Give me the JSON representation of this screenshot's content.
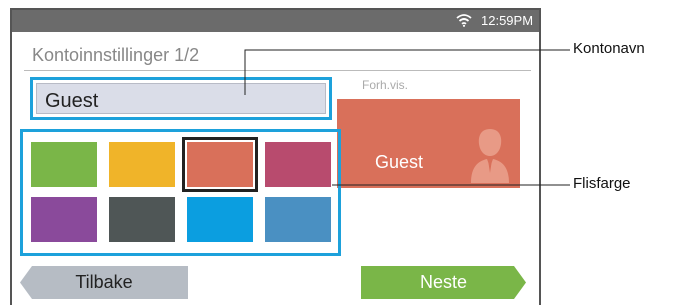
{
  "status_bar": {
    "time": "12:59PM",
    "wifi_icon": "wifi-icon"
  },
  "screen": {
    "title": "Kontoinnstillinger 1/2",
    "name_field": {
      "value": "Guest"
    },
    "preview": {
      "label": "Forh.vis.",
      "tile_name": "Guest",
      "tile_color": "#d9705a",
      "avatar_icon": "user-avatar-icon"
    },
    "tile_colors": [
      {
        "color": "#7ab648",
        "selected": false
      },
      {
        "color": "#f0b429",
        "selected": false
      },
      {
        "color": "#d9705a",
        "selected": true
      },
      {
        "color": "#b84b6e",
        "selected": false
      },
      {
        "color": "#8a4a9b",
        "selected": false
      },
      {
        "color": "#4f5656",
        "selected": false
      },
      {
        "color": "#0b9ee0",
        "selected": false
      },
      {
        "color": "#4a90c2",
        "selected": false
      }
    ],
    "buttons": {
      "back": "Tilbake",
      "next": "Neste"
    }
  },
  "callouts": {
    "account_name": "Kontonavn",
    "tile_color": "Flisfarge"
  }
}
